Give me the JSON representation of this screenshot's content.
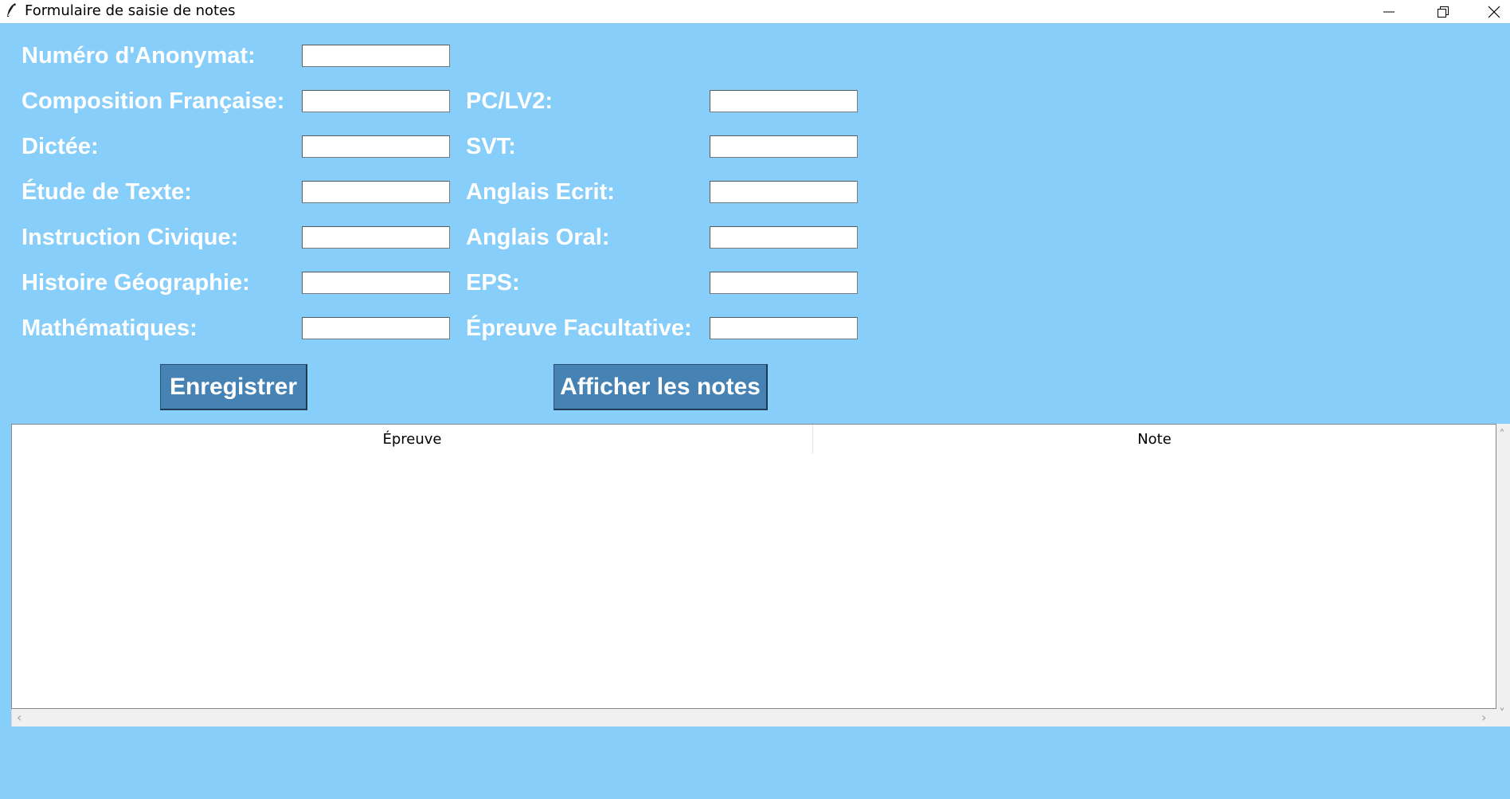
{
  "window": {
    "title": "Formulaire de saisie de notes",
    "icon": "feather-icon"
  },
  "form": {
    "left": [
      {
        "label": "Numéro d'Anonymat:",
        "value": ""
      },
      {
        "label": "Composition Française:",
        "value": ""
      },
      {
        "label": "Dictée:",
        "value": ""
      },
      {
        "label": "Étude de Texte:",
        "value": ""
      },
      {
        "label": "Instruction Civique:",
        "value": ""
      },
      {
        "label": "Histoire Géographie:",
        "value": ""
      },
      {
        "label": "Mathématiques:",
        "value": ""
      }
    ],
    "right": [
      {
        "label": "PC/LV2:",
        "value": ""
      },
      {
        "label": "SVT:",
        "value": ""
      },
      {
        "label": "Anglais Ecrit:",
        "value": ""
      },
      {
        "label": "Anglais Oral:",
        "value": ""
      },
      {
        "label": "EPS:",
        "value": ""
      },
      {
        "label": "Épreuve Facultative:",
        "value": ""
      }
    ]
  },
  "buttons": {
    "save": "Enregistrer",
    "show": "Afficher les notes"
  },
  "table": {
    "columns": [
      "Épreuve",
      "Note"
    ],
    "rows": []
  },
  "colors": {
    "background": "#87cefa",
    "button": "#4682b4",
    "label_text": "#ffffff"
  }
}
